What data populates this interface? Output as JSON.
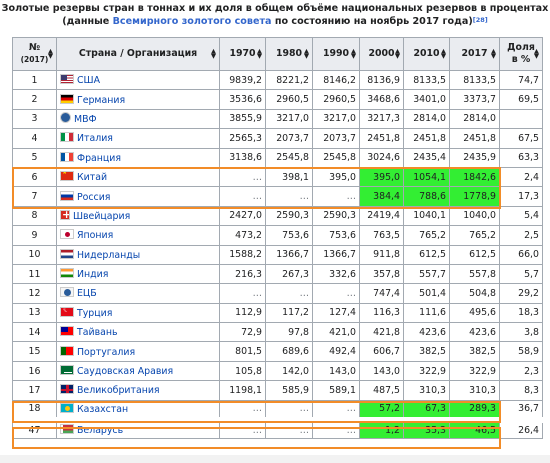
{
  "caption": {
    "line1": "Золотые резервы стран в тоннах и их доля в общем объёме национальных резервов в процентах",
    "line2_pre": "(данные ",
    "line2_link": "Всемирного золотого совета",
    "line2_post": " по состоянию на ноябрь 2017 года)",
    "ref": "[28]"
  },
  "headers": {
    "num": "№",
    "num_sub": "(2017)",
    "name": "Страна / Организация",
    "y1970": "1970",
    "y1980": "1980",
    "y1990": "1990",
    "y2000": "2000",
    "y2010": "2010",
    "y2017": "2017",
    "share": "Доля",
    "share_sub": "в %"
  },
  "sort_icons": "sort-arrows-icon",
  "rows": [
    {
      "n": "1",
      "flag": "usa-flag-icon",
      "name": "США",
      "v": [
        "9839,2",
        "8221,2",
        "8146,2",
        "8136,9",
        "8133,5",
        "8133,5"
      ],
      "share": "74,7"
    },
    {
      "n": "2",
      "flag": "germany-flag-icon",
      "name": "Германия",
      "v": [
        "3536,6",
        "2960,5",
        "2960,5",
        "3468,6",
        "3401,0",
        "3373,7"
      ],
      "share": "69,5"
    },
    {
      "n": "3",
      "flag": "imf-logo-icon",
      "name": "МВФ",
      "v": [
        "3855,9",
        "3217,0",
        "3217,0",
        "3217,3",
        "2814,0",
        "2814,0"
      ],
      "share": ""
    },
    {
      "n": "4",
      "flag": "italy-flag-icon",
      "name": "Италия",
      "v": [
        "2565,3",
        "2073,7",
        "2073,7",
        "2451,8",
        "2451,8",
        "2451,8"
      ],
      "share": "67,5"
    },
    {
      "n": "5",
      "flag": "france-flag-icon",
      "name": "Франция",
      "v": [
        "3138,6",
        "2545,8",
        "2545,8",
        "3024,6",
        "2435,4",
        "2435,9"
      ],
      "share": "63,3"
    },
    {
      "n": "6",
      "flag": "china-flag-icon",
      "name": "Китай",
      "v": [
        "…",
        "398,1",
        "395,0",
        "395,0",
        "1054,1",
        "1842,6"
      ],
      "share": "2,4"
    },
    {
      "n": "7",
      "flag": "russia-flag-icon",
      "name": "Россия",
      "v": [
        "…",
        "…",
        "…",
        "384,4",
        "788,6",
        "1778,9"
      ],
      "share": "17,3"
    },
    {
      "n": "8",
      "flag": "switzerland-flag-icon",
      "name": "Швейцария",
      "v": [
        "2427,0",
        "2590,3",
        "2590,3",
        "2419,4",
        "1040,1",
        "1040,0"
      ],
      "share": "5,4"
    },
    {
      "n": "9",
      "flag": "japan-flag-icon",
      "name": "Япония",
      "v": [
        "473,2",
        "753,6",
        "753,6",
        "763,5",
        "765,2",
        "765,2"
      ],
      "share": "2,5"
    },
    {
      "n": "10",
      "flag": "netherlands-flag-icon",
      "name": "Нидерланды",
      "v": [
        "1588,2",
        "1366,7",
        "1366,7",
        "911,8",
        "612,5",
        "612,5"
      ],
      "share": "66,0"
    },
    {
      "n": "11",
      "flag": "india-flag-icon",
      "name": "Индия",
      "v": [
        "216,3",
        "267,3",
        "332,6",
        "357,8",
        "557,7",
        "557,8"
      ],
      "share": "5,7"
    },
    {
      "n": "12",
      "flag": "ecb-logo-icon",
      "name": "ЕЦБ",
      "v": [
        "…",
        "…",
        "…",
        "747,4",
        "501,4",
        "504,8"
      ],
      "share": "29,2"
    },
    {
      "n": "13",
      "flag": "turkey-flag-icon",
      "name": "Турция",
      "v": [
        "112,9",
        "117,2",
        "127,4",
        "116,3",
        "111,6",
        "495,6"
      ],
      "share": "18,3"
    },
    {
      "n": "14",
      "flag": "taiwan-flag-icon",
      "name": "Тайвань",
      "v": [
        "72,9",
        "97,8",
        "421,0",
        "421,8",
        "423,6",
        "423,6"
      ],
      "share": "3,8"
    },
    {
      "n": "15",
      "flag": "portugal-flag-icon",
      "name": "Португалия",
      "v": [
        "801,5",
        "689,6",
        "492,4",
        "606,7",
        "382,5",
        "382,5"
      ],
      "share": "58,9"
    },
    {
      "n": "16",
      "flag": "saudi-arabia-flag-icon",
      "name": "Саудовская Аравия",
      "v": [
        "105,8",
        "142,0",
        "143,0",
        "143,0",
        "322,9",
        "322,9"
      ],
      "share": "2,3"
    },
    {
      "n": "17",
      "flag": "uk-flag-icon",
      "name": "Великобритания",
      "v": [
        "1198,1",
        "585,9",
        "589,1",
        "487,5",
        "310,3",
        "310,3"
      ],
      "share": "8,3"
    },
    {
      "n": "18",
      "flag": "kazakhstan-flag-icon",
      "name": "Казахстан",
      "v": [
        "…",
        "…",
        "…",
        "57,2",
        "67,3",
        "289,3"
      ],
      "share": "36,7"
    },
    {
      "n": "47",
      "flag": "belarus-flag-icon",
      "name": "Беларусь",
      "v": [
        "…",
        "…",
        "…",
        "1,2",
        "35,3",
        "46,5"
      ],
      "share": "26,4"
    }
  ],
  "highlight_color": "#33ee33",
  "outline_color": "#f28c28",
  "link_color": "#0645ad"
}
